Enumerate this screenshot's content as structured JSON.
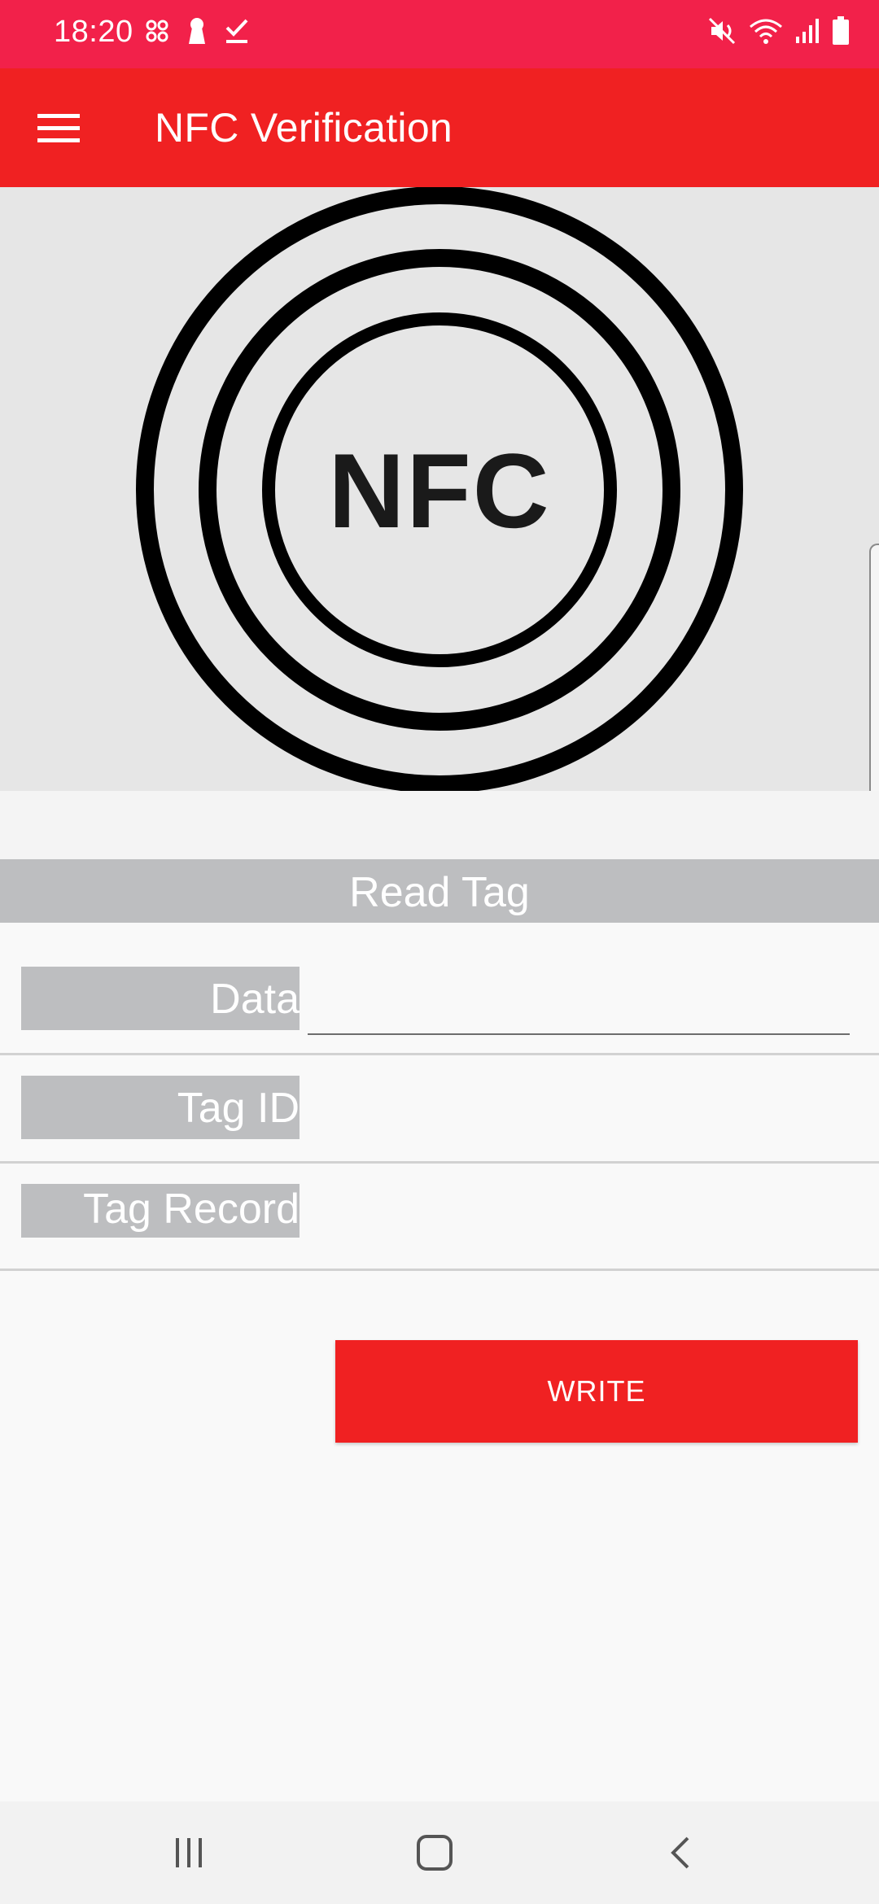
{
  "status_bar": {
    "time": "18:20",
    "left_icons": [
      "app-icon",
      "keyhole-icon",
      "checkmark-icon"
    ],
    "right_icons": [
      "mute-icon",
      "wifi-icon",
      "signal-icon",
      "battery-icon"
    ]
  },
  "app_bar": {
    "title": "NFC Verification",
    "menu_icon": "hamburger-menu-icon"
  },
  "hero": {
    "logo_text": "NFC"
  },
  "read_tag": {
    "header": "Read Tag",
    "fields": [
      {
        "label": "Data",
        "value": ""
      },
      {
        "label": "Tag ID",
        "value": ""
      },
      {
        "label": "Tag Record",
        "value": ""
      }
    ]
  },
  "actions": {
    "write_label": "WRITE"
  },
  "nav_bar": {
    "items": [
      "recents-icon",
      "home-icon",
      "back-icon"
    ]
  },
  "colors": {
    "status_bar": "#f2214a",
    "app_bar": "#f02122",
    "label_bg": "#bdbec0",
    "button": "#f02122"
  }
}
